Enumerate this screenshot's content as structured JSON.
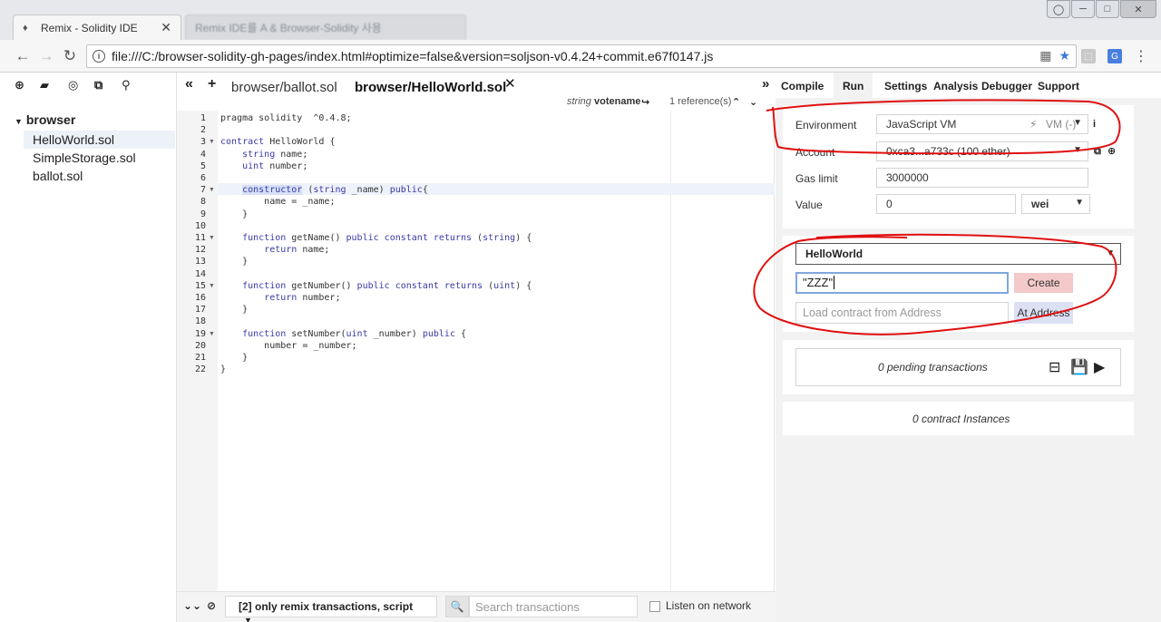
{
  "browser": {
    "tabs": [
      {
        "title": "Remix - Solidity IDE",
        "close": "✕"
      },
      {
        "title": "Remix IDE를 A & Browser-Solidity 사용"
      }
    ],
    "url": "file:///C:/browser-solidity-gh-pages/index.html#optimize=false&version=soljson-v0.4.24+commit.e67f0147.js",
    "icons": {
      "back": "back-arrow-icon",
      "forward": "forward-arrow-icon",
      "reload": "reload-icon",
      "star": "bookmark-star-icon",
      "menu": "menu-dots-icon"
    }
  },
  "file_explorer": {
    "root": "browser",
    "files": [
      "HelloWorld.sol",
      "SimpleStorage.sol",
      "ballot.sol"
    ],
    "selected": "HelloWorld.sol"
  },
  "editor": {
    "tabs": [
      "browser/ballot.sol",
      "browser/HelloWorld.sol"
    ],
    "active_tab": "browser/HelloWorld.sol",
    "close": "✕",
    "info": {
      "type": "string",
      "name": "votename",
      "refs": "1 reference(s)"
    },
    "lines": [
      "pragma solidity  ^0.4.8;",
      "",
      "contract HelloWorld {",
      "    string name;",
      "    uint number;",
      "",
      "    constructor (string _name) public{",
      "        name = _name;",
      "    }",
      "",
      "    function getName() public constant returns (string) {",
      "        return name;",
      "    }",
      "",
      "    function getNumber() public constant returns (uint) {",
      "        return number;",
      "    }",
      "",
      "    function setNumber(uint _number) public {",
      "        number = _number;",
      "    }",
      "}"
    ],
    "fold_lines": [
      3,
      7,
      11,
      15,
      19
    ],
    "highlighted_line": 7
  },
  "terminal": {
    "filter": "[2] only remix transactions, script",
    "search_placeholder": "Search transactions",
    "listen_label": "Listen on network"
  },
  "run_panel": {
    "tabs": [
      "Compile",
      "Run",
      "Settings",
      "Analysis",
      "Debugger",
      "Support"
    ],
    "active_tab": "Run",
    "environment_label": "Environment",
    "environment_value": "JavaScript VM",
    "vm_badge": "VM (-)",
    "account_label": "Account",
    "account_value": "0xca3...a733c (100 ether)",
    "gas_label": "Gas limit",
    "gas_value": "3000000",
    "value_label": "Value",
    "value_value": "0",
    "unit_value": "wei",
    "contract": "HelloWorld",
    "ctor_arg": "\"ZZZ\"",
    "create_label": "Create",
    "load_placeholder": "Load contract from Address",
    "at_address_label": "At Address",
    "pending": "0 pending transactions",
    "instances": "0 contract Instances"
  },
  "colors": {
    "annotation": "#e01010",
    "create_bg": "#f4c9c9",
    "at_address_bg": "#dce0f3",
    "keyword": "#3a3aa8"
  }
}
